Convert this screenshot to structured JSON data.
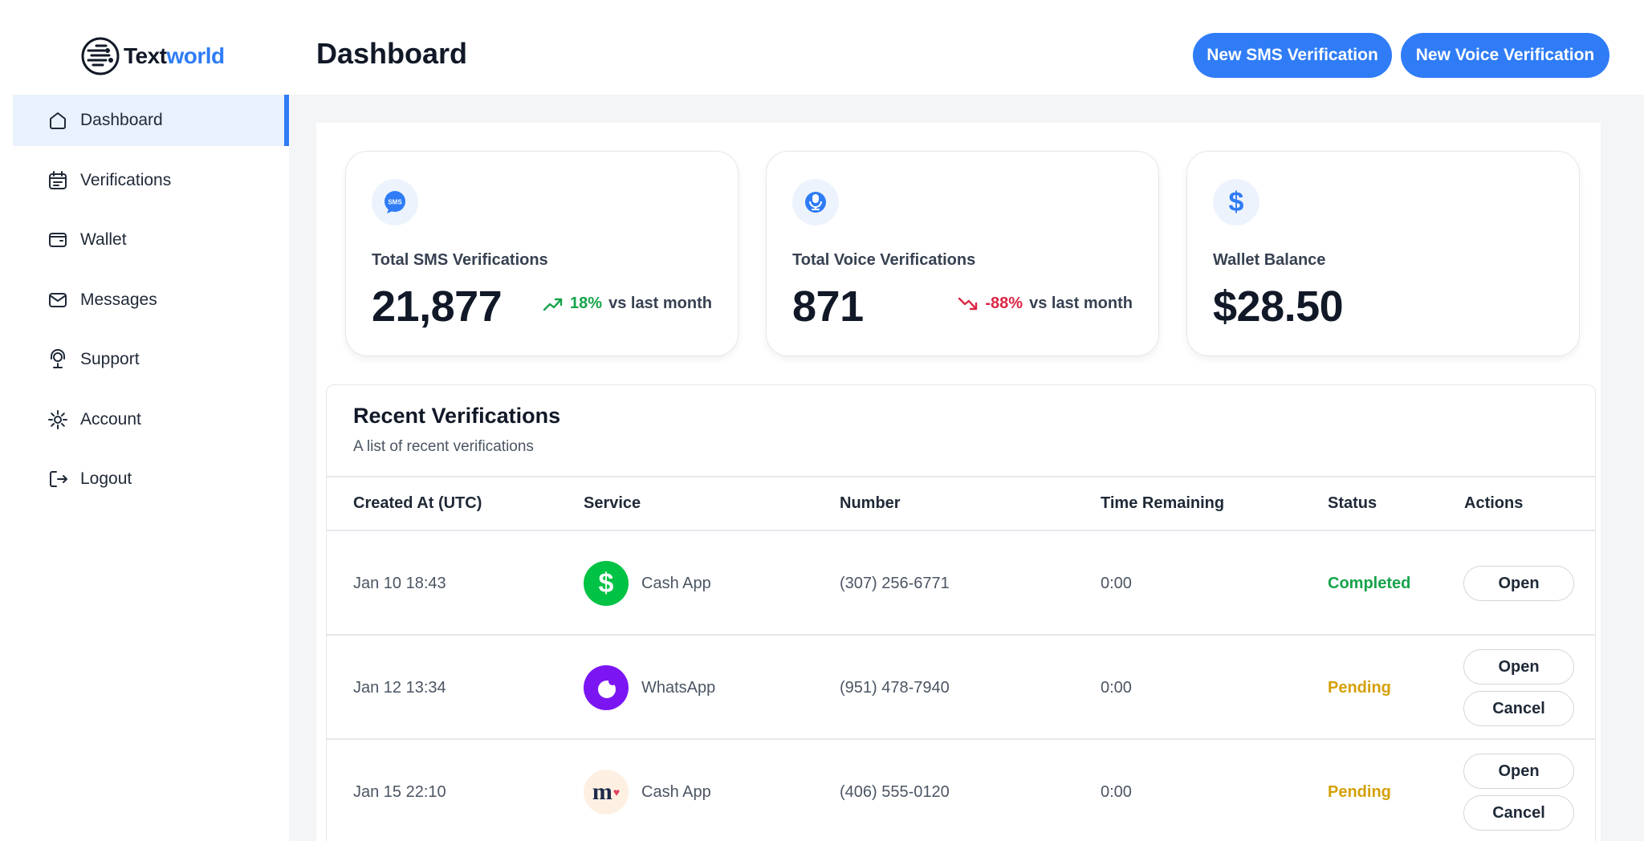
{
  "brand": {
    "name_part1": "Text",
    "name_part2": "world"
  },
  "sidebar": {
    "items": [
      {
        "label": "Dashboard",
        "icon": "home-icon",
        "active": true
      },
      {
        "label": "Verifications",
        "icon": "calendar-list-icon"
      },
      {
        "label": "Wallet",
        "icon": "wallet-icon"
      },
      {
        "label": "Messages",
        "icon": "mail-icon"
      },
      {
        "label": "Support",
        "icon": "support-agent-icon"
      },
      {
        "label": "Account",
        "icon": "gear-icon"
      },
      {
        "label": "Logout",
        "icon": "logout-icon"
      }
    ]
  },
  "header": {
    "title": "Dashboard",
    "new_sms_label": "New SMS Verification",
    "new_voice_label": "New Voice Verification"
  },
  "stats": [
    {
      "label": "Total SMS Verifications",
      "value": "21,877",
      "trend": "18%",
      "trend_dir": "up",
      "trend_note": "vs last month",
      "icon": "sms-bubble-icon",
      "icon_text": "SMS"
    },
    {
      "label": "Total Voice Verifications",
      "value": "871",
      "trend": "-88%",
      "trend_dir": "down",
      "trend_note": "vs last month",
      "icon": "voice-icon"
    },
    {
      "label": "Wallet Balance",
      "value": "$28.50",
      "icon": "dollar-icon",
      "icon_text": "$"
    }
  ],
  "recent": {
    "title": "Recent Verifications",
    "subtitle": "A list of recent verifications",
    "columns": [
      "Created At (UTC)",
      "Service",
      "Number",
      "Time Remaining",
      "Status",
      "Actions"
    ],
    "rows": [
      {
        "created": "Jan 10 18:43",
        "service": "Cash App",
        "logo": "cashapp-logo-icon",
        "logo_text": "$",
        "number": "(307) 256-6771",
        "time": "0:00",
        "status": "Completed",
        "actions": [
          "Open"
        ]
      },
      {
        "created": "Jan 12 13:34",
        "service": "WhatsApp",
        "logo": "whatsapp-logo-icon",
        "number": "(951) 478-7940",
        "time": "0:00",
        "status": "Pending",
        "actions": [
          "Open",
          "Cancel"
        ]
      },
      {
        "created": "Jan 15 22:10",
        "service": "Cash App",
        "logo": "m-brand-logo-icon",
        "logo_text": "m",
        "number": "(406) 555-0120",
        "time": "0:00",
        "status": "Pending",
        "actions": [
          "Open",
          "Cancel"
        ]
      }
    ]
  },
  "colors": {
    "accent": "#2f7cf6",
    "success": "#16a34a",
    "danger": "#dc2645",
    "pending": "#d4a006",
    "active_bg": "#e9f1fd"
  }
}
